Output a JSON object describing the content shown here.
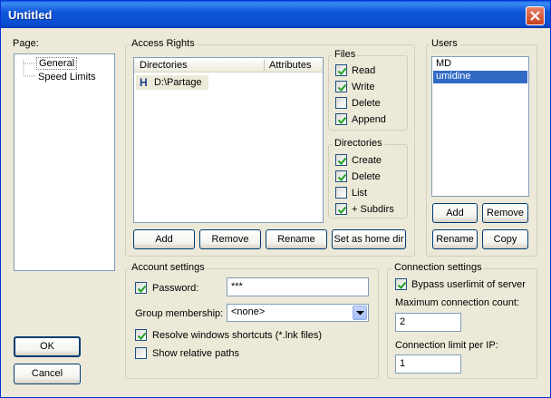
{
  "window": {
    "title": "Untitled"
  },
  "page_panel": {
    "label": "Page:",
    "items": [
      {
        "label": "General",
        "selected": true
      },
      {
        "label": "Speed Limits",
        "selected": false
      }
    ]
  },
  "access_rights": {
    "label": "Access Rights",
    "columns": [
      "Directories",
      "Attributes"
    ],
    "rows": [
      {
        "marker": "H",
        "path": "D:\\Partage"
      }
    ],
    "buttons": {
      "add": "Add",
      "remove": "Remove",
      "rename": "Rename",
      "home": "Set as home dir"
    },
    "files": {
      "label": "Files",
      "items": [
        {
          "label": "Read",
          "checked": true
        },
        {
          "label": "Write",
          "checked": true
        },
        {
          "label": "Delete",
          "checked": false
        },
        {
          "label": "Append",
          "checked": true
        }
      ]
    },
    "directories": {
      "label": "Directories",
      "items": [
        {
          "label": "Create",
          "checked": true
        },
        {
          "label": "Delete",
          "checked": true
        },
        {
          "label": "List",
          "checked": false
        },
        {
          "label": "+ Subdirs",
          "checked": true
        }
      ]
    }
  },
  "users": {
    "label": "Users",
    "list": [
      {
        "name": "MD",
        "selected": false
      },
      {
        "name": "umidine",
        "selected": true
      }
    ],
    "buttons": {
      "add": "Add",
      "remove": "Remove",
      "rename": "Rename",
      "copy": "Copy"
    }
  },
  "account": {
    "label": "Account settings",
    "password_label": "Password:",
    "password_checked": true,
    "password_value": "***",
    "group_label": "Group membership:",
    "group_value": "<none>",
    "resolve_label": "Resolve windows shortcuts (*.lnk files)",
    "resolve_checked": true,
    "relative_label": "Show relative paths",
    "relative_checked": false
  },
  "connection": {
    "label": "Connection settings",
    "bypass_label": "Bypass userlimit of server",
    "bypass_checked": true,
    "max_label": "Maximum connection count:",
    "max_value": "2",
    "perip_label": "Connection limit per IP:",
    "perip_value": "1"
  },
  "dialog_buttons": {
    "ok": "OK",
    "cancel": "Cancel"
  },
  "colors": {
    "titlebar": "#0a4ed0",
    "selection": "#316ac5",
    "dialog_bg": "#ece9d8"
  }
}
